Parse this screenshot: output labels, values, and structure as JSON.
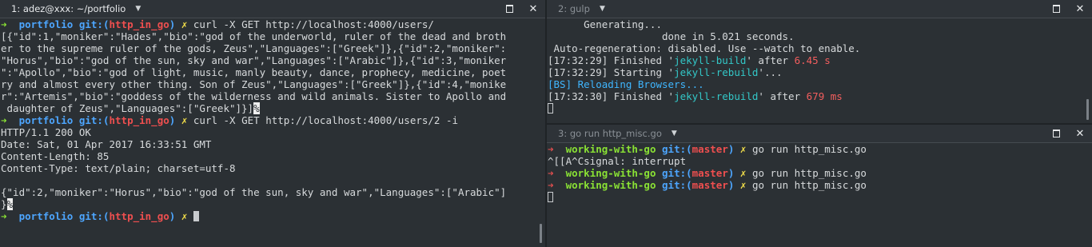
{
  "panes": {
    "left": {
      "title": "1: adez@xxx: ~/portfolio",
      "prompt_dir": "portfolio",
      "git_prefix": "git:(",
      "branch": "http_in_go",
      "git_suffix": ")",
      "dirty": "✗",
      "cmd1": "curl -X GET http://localhost:4000/users/",
      "out1": [
        "[{\"id\":1,\"moniker\":\"Hades\",\"bio\":\"god of the underworld, ruler of the dead and broth",
        "er to the supreme ruler of the gods, Zeus\",\"Languages\":[\"Greek\"]},{\"id\":2,\"moniker\":",
        "\"Horus\",\"bio\":\"god of the sun, sky and war\",\"Languages\":[\"Arabic\"]},{\"id\":3,\"moniker",
        "\":\"Apollo\",\"bio\":\"god of light, music, manly beauty, dance, prophecy, medicine, poet",
        "ry and almost every other thing. Son of Zeus\",\"Languages\":[\"Greek\"]},{\"id\":4,\"monike",
        "r\":\"Artemis\",\"bio\":\"goddess of the wilderness and wild animals. Sister to Apollo and",
        " daughter of Zeus\",\"Languages\":[\"Greek\"]}]"
      ],
      "eol_mark": "%",
      "cmd2": "curl -X GET http://localhost:4000/users/2 -i",
      "out2": [
        "HTTP/1.1 200 OK",
        "Date: Sat, 01 Apr 2017 16:33:51 GMT",
        "Content-Length: 85",
        "Content-Type: text/plain; charset=utf-8",
        "",
        "{\"id\":2,\"moniker\":\"Horus\",\"bio\":\"god of the sun, sky and war\",\"Languages\":[\"Arabic\"]"
      ],
      "out2_tail": "}"
    },
    "top_right": {
      "title": "2: gulp",
      "l1": "      Generating...",
      "l2": "                   done in 5.021 seconds.",
      "l3": " Auto-regeneration: disabled. Use --watch to enable.",
      "r1_time": "[17:32:29]",
      "r1_a": " Finished '",
      "r1_task": "jekyll-build",
      "r1_b": "' after ",
      "r1_dur": "6.45 s",
      "r2_time": "[17:32:29]",
      "r2_a": " Starting '",
      "r2_task": "jekyll-rebuild",
      "r2_b": "'...",
      "r3_tag": "[BS]",
      "r3_msg": " Reloading Browsers...",
      "r4_time": "[17:32:30]",
      "r4_a": " Finished '",
      "r4_task": "jekyll-rebuild",
      "r4_b": "' after ",
      "r4_dur": "679 ms"
    },
    "bottom_right": {
      "title": "3: go run http_misc.go",
      "prompt_dir": "working-with-go",
      "git_prefix": "git:(",
      "branch": "master",
      "git_suffix": ")",
      "dirty": "✗",
      "cmd": "go run http_misc.go",
      "interrupt": "^[[A^Csignal: interrupt"
    }
  },
  "symbols": {
    "prompt_arrow": "➜",
    "caret": "▼",
    "close": "✕"
  }
}
